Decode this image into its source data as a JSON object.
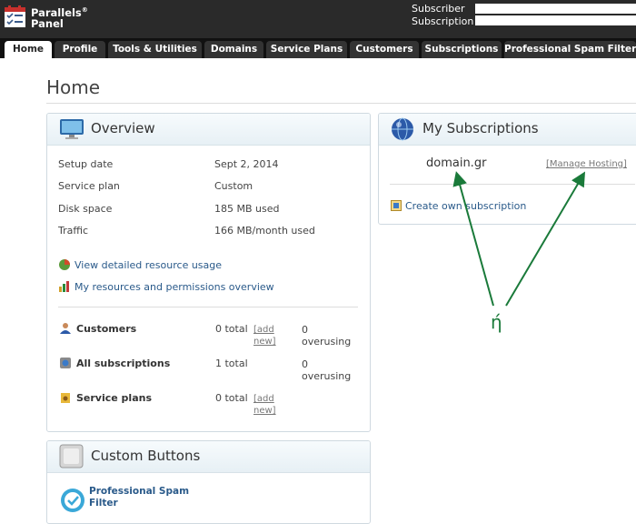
{
  "header": {
    "logo_line1": "Parallels",
    "logo_reg": "®",
    "logo_line2": "Panel",
    "subscriber_label": "Subscriber",
    "subscription_label": "Subscription"
  },
  "tabs": [
    {
      "label": "Home",
      "active": true
    },
    {
      "label": "Profile"
    },
    {
      "label": "Tools & Utilities"
    },
    {
      "label": "Domains"
    },
    {
      "label": "Service Plans"
    },
    {
      "label": "Customers"
    },
    {
      "label": "Subscriptions"
    },
    {
      "label": "Professional Spam Filter"
    }
  ],
  "page_title": "Home",
  "overview": {
    "title": "Overview",
    "rows": [
      {
        "label": "Setup date",
        "value": "Sept 2, 2014"
      },
      {
        "label": "Service plan",
        "value": "Custom"
      },
      {
        "label": "Disk space",
        "value": "185 MB used"
      },
      {
        "label": "Traffic",
        "value": "166 MB/month used"
      }
    ],
    "link_resource_usage": "View detailed resource usage",
    "link_permissions": "My resources and permissions overview",
    "stats": [
      {
        "label": "Customers",
        "total": "0 total",
        "add": "[add new]",
        "over_count": "0",
        "over_label": "overusing"
      },
      {
        "label": "All subscriptions",
        "total": "1 total",
        "over_count": "0",
        "over_label": "overusing"
      },
      {
        "label": "Service plans",
        "total": "0 total",
        "add": "[add new]"
      }
    ]
  },
  "custom_buttons": {
    "title": "Custom Buttons",
    "item": "Professional Spam Filter"
  },
  "subscriptions": {
    "title": "My Subscriptions",
    "domain": "domain.gr",
    "manage": "[Manage Hosting]",
    "create": "Create own subscription"
  },
  "annotation": {
    "text": "ή",
    "color": "#1a7a3a"
  },
  "colors": {
    "link": "#2a5a8a",
    "topbar": "#2a2a2a",
    "tab": "#333333",
    "panel_border": "#cfd9e0"
  }
}
